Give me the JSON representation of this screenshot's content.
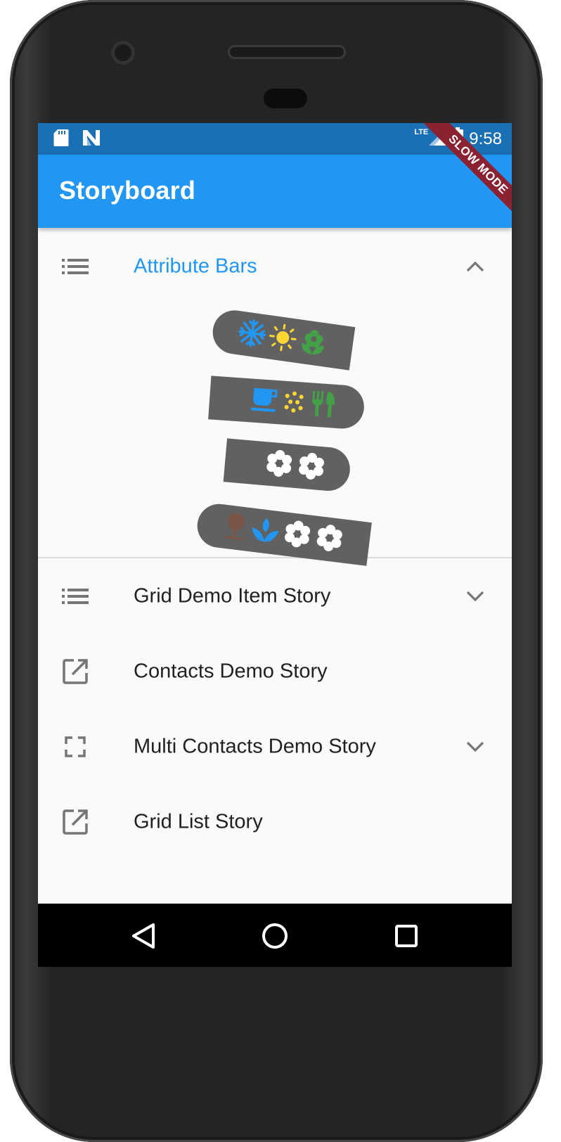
{
  "status_bar": {
    "time": "9:58",
    "network": "LTE",
    "icons": [
      "sd-card-icon",
      "n-notification-icon",
      "signal-icon",
      "battery-charging-icon"
    ]
  },
  "debug_banner": "SLOW MODE",
  "app_bar": {
    "title": "Storyboard"
  },
  "stories": [
    {
      "label": "Attribute Bars",
      "icon": "list-icon",
      "trailing": "chevron-up-icon",
      "expanded": true
    },
    {
      "label": "Grid Demo Item Story",
      "icon": "list-icon",
      "trailing": "chevron-down-icon",
      "expanded": false
    },
    {
      "label": "Contacts Demo Story",
      "icon": "open-in-new-icon",
      "trailing": null,
      "expanded": false
    },
    {
      "label": "Multi Contacts Demo Story",
      "icon": "fullscreen-icon",
      "trailing": "chevron-down-icon",
      "expanded": false
    },
    {
      "label": "Grid List Story",
      "icon": "open-in-new-icon",
      "trailing": null,
      "expanded": false
    }
  ],
  "attribute_bars": [
    {
      "icons": [
        "snowflake-icon",
        "sun-icon",
        "flower-icon"
      ]
    },
    {
      "icons": [
        "coffee-cup-icon",
        "sparkle-icon",
        "restaurant-icon"
      ]
    },
    {
      "icons": [
        "white-flower-icon",
        "white-flower-icon"
      ]
    },
    {
      "icons": [
        "tree-icon",
        "lotus-icon",
        "white-flower-icon",
        "white-flower-icon"
      ]
    }
  ],
  "colors": {
    "primary": "#2196f3",
    "status_bar": "#1a6fb5",
    "bar_gray": "#616161",
    "snow_blue": "#2196f3",
    "sun_yellow": "#fdd835",
    "leaf_green": "#43a047",
    "tree_brown": "#795548",
    "banner_red": "#8b2232"
  },
  "system_nav": [
    "back-icon",
    "home-icon",
    "recents-icon"
  ]
}
